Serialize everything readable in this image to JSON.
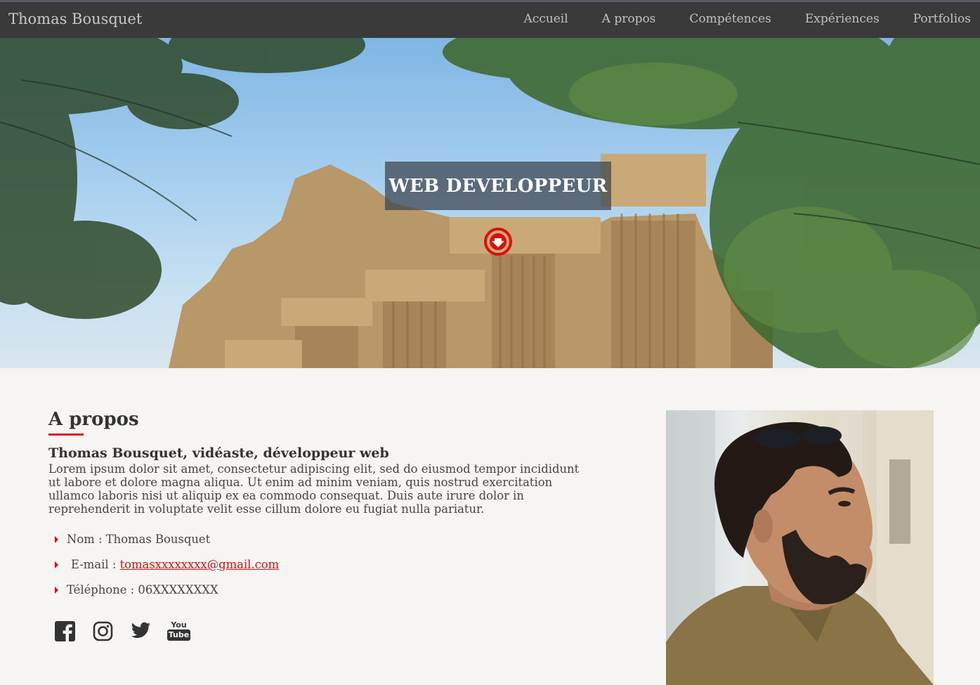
{
  "header": {
    "brand": "Thomas Bousquet",
    "nav": [
      "Accueil",
      "A propos",
      "Compétences",
      "Expériences",
      "Portfolios"
    ]
  },
  "hero": {
    "title": "WEB DEVELOPPEUR",
    "scroll_icon": "arrow-down-circle-icon"
  },
  "about": {
    "title": "A propos",
    "subtitle": "Thomas Bousquet, vidéaste, développeur web",
    "text": "Lorem ipsum dolor sit amet, consectetur adipiscing elit, sed do eiusmod tempor incididunt ut labore et dolore magna aliqua. Ut enim ad minim veniam, quis nostrud exercitation ullamco laboris nisi ut aliquip ex ea commodo consequat. Duis aute irure dolor in reprehenderit in voluptate velit esse cillum dolore eu fugiat nulla pariatur.",
    "name_label": "Nom : ",
    "name_value": "Thomas Bousquet",
    "email_label": "E-mail : ",
    "email_value": "tomasxxxxxxxx@gmail.com",
    "phone_label": "Téléphone : ",
    "phone_value": "06XXXXXXXX",
    "social_icons": [
      "facebook-icon",
      "instagram-icon",
      "twitter-icon",
      "youtube-icon"
    ],
    "youtube_text": [
      "You",
      "Tube"
    ]
  },
  "colors": {
    "navbar": "#3a3a3a",
    "accent": "#e01414",
    "background": "#f6f5f3"
  }
}
